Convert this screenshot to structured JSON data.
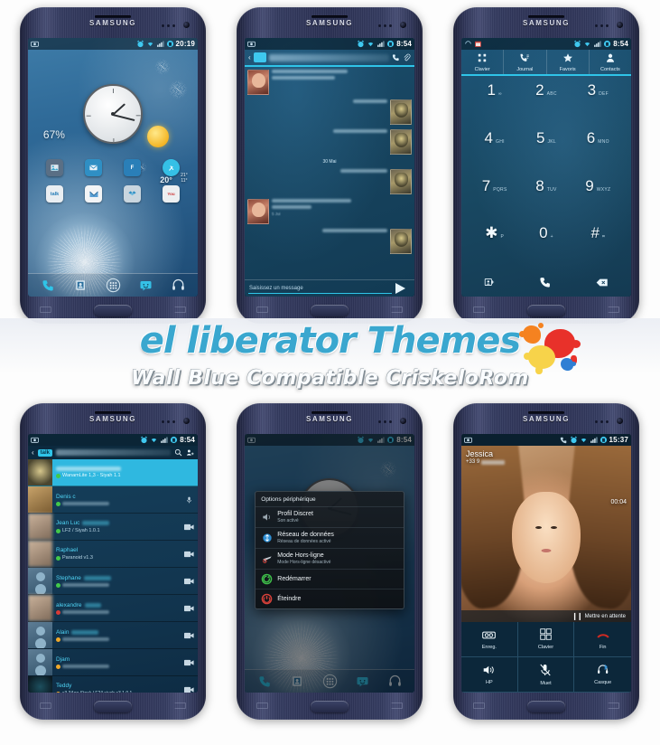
{
  "banner": {
    "title": "el liberator Themes",
    "subtitle": "Wall Blue  Compatible CriskeloRom",
    "title_color": "#3aa7cf",
    "splat_colors": [
      "#f58220",
      "#e8312a",
      "#f7d34a",
      "#2f7fd4"
    ]
  },
  "brand": "SAMSUNG",
  "phones": {
    "home": {
      "status": {
        "clock": "20:19",
        "icons": [
          "alarm-icon",
          "wifi-icon",
          "signal-icon",
          "battery-icon"
        ]
      },
      "battery_percent": "67%",
      "weather": {
        "current": "20°",
        "high": "21°",
        "low": "11°",
        "condition": "sunny"
      },
      "clock_widget": {
        "hour_label": "analog-clock"
      },
      "app_icons": [
        {
          "name": "gallery-icon",
          "label": "",
          "color": "#5a6f85"
        },
        {
          "name": "email-icon",
          "label": "",
          "color": "#2f8fc4"
        },
        {
          "name": "flipboard-icon",
          "label": "F",
          "color": "#2a7fb8"
        },
        {
          "name": "tools-icon",
          "label": "",
          "color": "#35c0e6"
        },
        {
          "name": "talk-icon",
          "label": "talk",
          "color": "#e9eef2"
        },
        {
          "name": "gmail-icon",
          "label": "M",
          "color": "#f2f4f6"
        },
        {
          "name": "dropbox-icon",
          "label": "",
          "color": "#c9d6df"
        },
        {
          "name": "youtube-icon",
          "label": "You",
          "color": "#eceff1"
        }
      ],
      "dock": [
        {
          "name": "phone-icon",
          "glyph": "✆"
        },
        {
          "name": "contacts-icon",
          "glyph": "▣"
        },
        {
          "name": "app-drawer-icon",
          "glyph": "∷"
        },
        {
          "name": "messaging-icon",
          "glyph": "☺"
        },
        {
          "name": "music-icon",
          "glyph": "♫"
        }
      ]
    },
    "messaging": {
      "status": {
        "clock": "8:54"
      },
      "header": {
        "contact_name": "",
        "call_icon": "phone-icon",
        "attach_icon": "paperclip-icon"
      },
      "date_separators": [
        "30 Mai",
        "5 Jui"
      ],
      "messages": [
        {
          "side": "them",
          "lines": 2,
          "stamp": ""
        },
        {
          "side": "me",
          "lines": 1,
          "stamp": ""
        },
        {
          "side": "me",
          "lines": 1,
          "stamp": ""
        },
        {
          "side": "them",
          "lines": 2,
          "stamp": "5 Jui"
        },
        {
          "side": "me",
          "lines": 1,
          "stamp": ""
        }
      ],
      "input_placeholder": "Saisissez un message",
      "send_icon": "send-icon"
    },
    "dialer": {
      "status": {
        "clock": "8:54"
      },
      "tabs": [
        {
          "label": "Clavier",
          "icon": "keypad-icon",
          "glyph": "∷",
          "active": true
        },
        {
          "label": "Journal",
          "icon": "call-log-icon",
          "glyph": "✆",
          "active": false
        },
        {
          "label": "Favoris",
          "icon": "star-icon",
          "glyph": "★",
          "active": false
        },
        {
          "label": "Contacts",
          "icon": "person-icon",
          "glyph": "♟",
          "active": false
        }
      ],
      "keys": [
        {
          "num": "1",
          "sub": "∞"
        },
        {
          "num": "2",
          "sub": "ABC"
        },
        {
          "num": "3",
          "sub": "DEF"
        },
        {
          "num": "4",
          "sub": "GHI"
        },
        {
          "num": "5",
          "sub": "JKL"
        },
        {
          "num": "6",
          "sub": "MNO"
        },
        {
          "num": "7",
          "sub": "PQRS"
        },
        {
          "num": "8",
          "sub": "TUV"
        },
        {
          "num": "9",
          "sub": "WXYZ"
        },
        {
          "num": "✱",
          "sub": "P"
        },
        {
          "num": "0",
          "sub": "+"
        },
        {
          "num": "#",
          "sub": "⌗"
        }
      ],
      "actions": [
        {
          "name": "add-contact-icon",
          "glyph": "❑"
        },
        {
          "name": "call-icon",
          "glyph": "✆"
        },
        {
          "name": "backspace-icon",
          "glyph": "⌫"
        }
      ]
    },
    "talk": {
      "status": {
        "clock": "8:54"
      },
      "appbar": {
        "logo": "talk",
        "account": "",
        "search_icon": "search-icon",
        "add_icon": "add-person-icon"
      },
      "contacts": [
        {
          "name": "",
          "status": "WanamLite 1,3 - Siyah 1.1",
          "presence": "on",
          "selected": true,
          "avatar": "hood",
          "action": ""
        },
        {
          "name": "Denis c",
          "status": "",
          "presence": "on",
          "selected": false,
          "avatar": "cat",
          "action": "mic-icon"
        },
        {
          "name": "Jean Luc",
          "status": "LF2 / Siyah 1.0.1",
          "presence": "on",
          "selected": false,
          "avatar": "blurface",
          "action": "video-icon"
        },
        {
          "name": "Raphael",
          "status": "Paranoid v1.3",
          "presence": "on",
          "selected": false,
          "avatar": "blurface",
          "action": "video-icon"
        },
        {
          "name": "Stephane",
          "status": "",
          "presence": "on",
          "selected": false,
          "avatar": "person",
          "action": "video-icon"
        },
        {
          "name": "alexandre",
          "status": "",
          "presence": "busy",
          "selected": false,
          "avatar": "blurface",
          "action": "video-icon"
        },
        {
          "name": "Alain",
          "status": "",
          "presence": "away",
          "selected": false,
          "avatar": "person",
          "action": "video-icon"
        },
        {
          "name": "Djam",
          "status": "",
          "presence": "away",
          "selected": false,
          "avatar": "person",
          "action": "video-icon"
        },
        {
          "name": "Teddy",
          "status": "s3 3Age Stock LF2// siyah s3 1.0.1",
          "presence": "away",
          "selected": false,
          "avatar": "dark2",
          "action": "video-icon"
        }
      ]
    },
    "power": {
      "status": {
        "clock": "8:54"
      },
      "dialog_title": "Options périphérique",
      "items": [
        {
          "label": "Profil Discret",
          "sub": "Son activé",
          "icon": "speaker-icon",
          "color": "#9aa7b0"
        },
        {
          "label": "Réseau de données",
          "sub": "Réseau de données activé",
          "icon": "data-network-icon",
          "color": "#2f8fd4"
        },
        {
          "label": "Mode Hors-ligne",
          "sub": "Mode Hors-ligne désactivé",
          "icon": "airplane-icon",
          "color": "#c9d2d8"
        },
        {
          "label": "Redémarrer",
          "sub": "",
          "icon": "restart-icon",
          "color": "#3fc04a"
        },
        {
          "label": "Éteindre",
          "sub": "",
          "icon": "power-icon",
          "color": "#d8413a"
        }
      ]
    },
    "call": {
      "status": {
        "clock": "15:37"
      },
      "caller_name": "Jessica",
      "caller_number_prefix": "+33 9",
      "timer": "00:04",
      "hold_label": "Mettre en attente",
      "buttons": [
        {
          "label": "Enreg.",
          "icon": "record-icon",
          "glyph": "⏺"
        },
        {
          "label": "Clavier",
          "icon": "keypad-icon",
          "glyph": "∷"
        },
        {
          "label": "Fin",
          "icon": "end-call-icon",
          "glyph": "✆"
        },
        {
          "label": "HP",
          "icon": "speaker-icon",
          "glyph": "◂"
        },
        {
          "label": "Muet",
          "icon": "mute-icon",
          "glyph": "⊘"
        },
        {
          "label": "Casque",
          "icon": "headset-bluetooth-icon",
          "glyph": "∩"
        }
      ]
    }
  }
}
